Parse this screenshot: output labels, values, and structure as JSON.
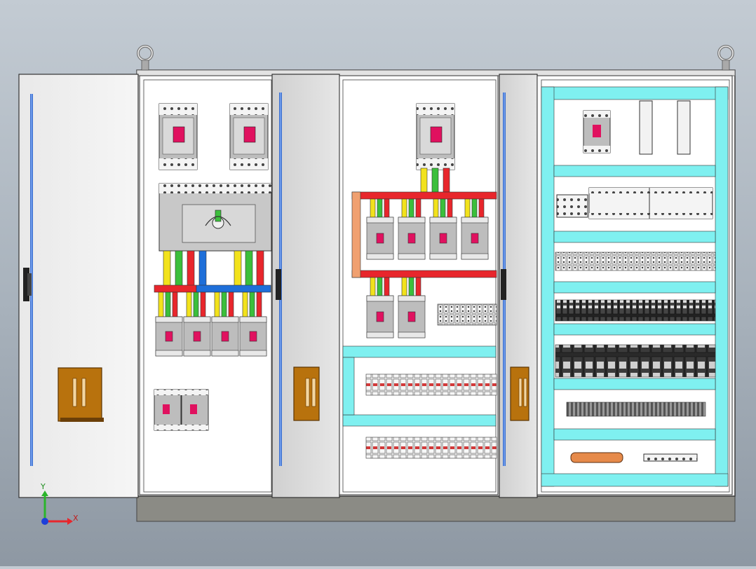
{
  "scene": {
    "type": "electrical-control-cabinet-cad-model",
    "view": "front",
    "cabinet_sections": 3,
    "open_doors": 3
  },
  "colors": {
    "background_top": "#c3cbd3",
    "background_bottom": "#8e98a3",
    "cabinet_frame": "#f2f2f2",
    "plinth": "#8b8b85",
    "busbar_red": "#e8262c",
    "busbar_blue": "#1e6fd9",
    "busbar_yellow": "#f2e21c",
    "busbar_green": "#3bbf3b",
    "cable_duct_cyan": "#7ff0f0",
    "breaker_gray": "#bdbdbd",
    "breaker_handle": "#e0115f",
    "door_handle": "#b8720d",
    "copper_bar": "#e68a4a"
  },
  "icons": {
    "lifting_eye": "lifting-eye-icon",
    "door_handle": "door-handle-icon",
    "isolator_switch": "rotary-isolator-icon"
  },
  "axis_triad": {
    "x_label": "X",
    "y_label": "Y",
    "x_color": "#e8262c",
    "y_color": "#2bb52b",
    "z_color": "#1e3fd9"
  }
}
